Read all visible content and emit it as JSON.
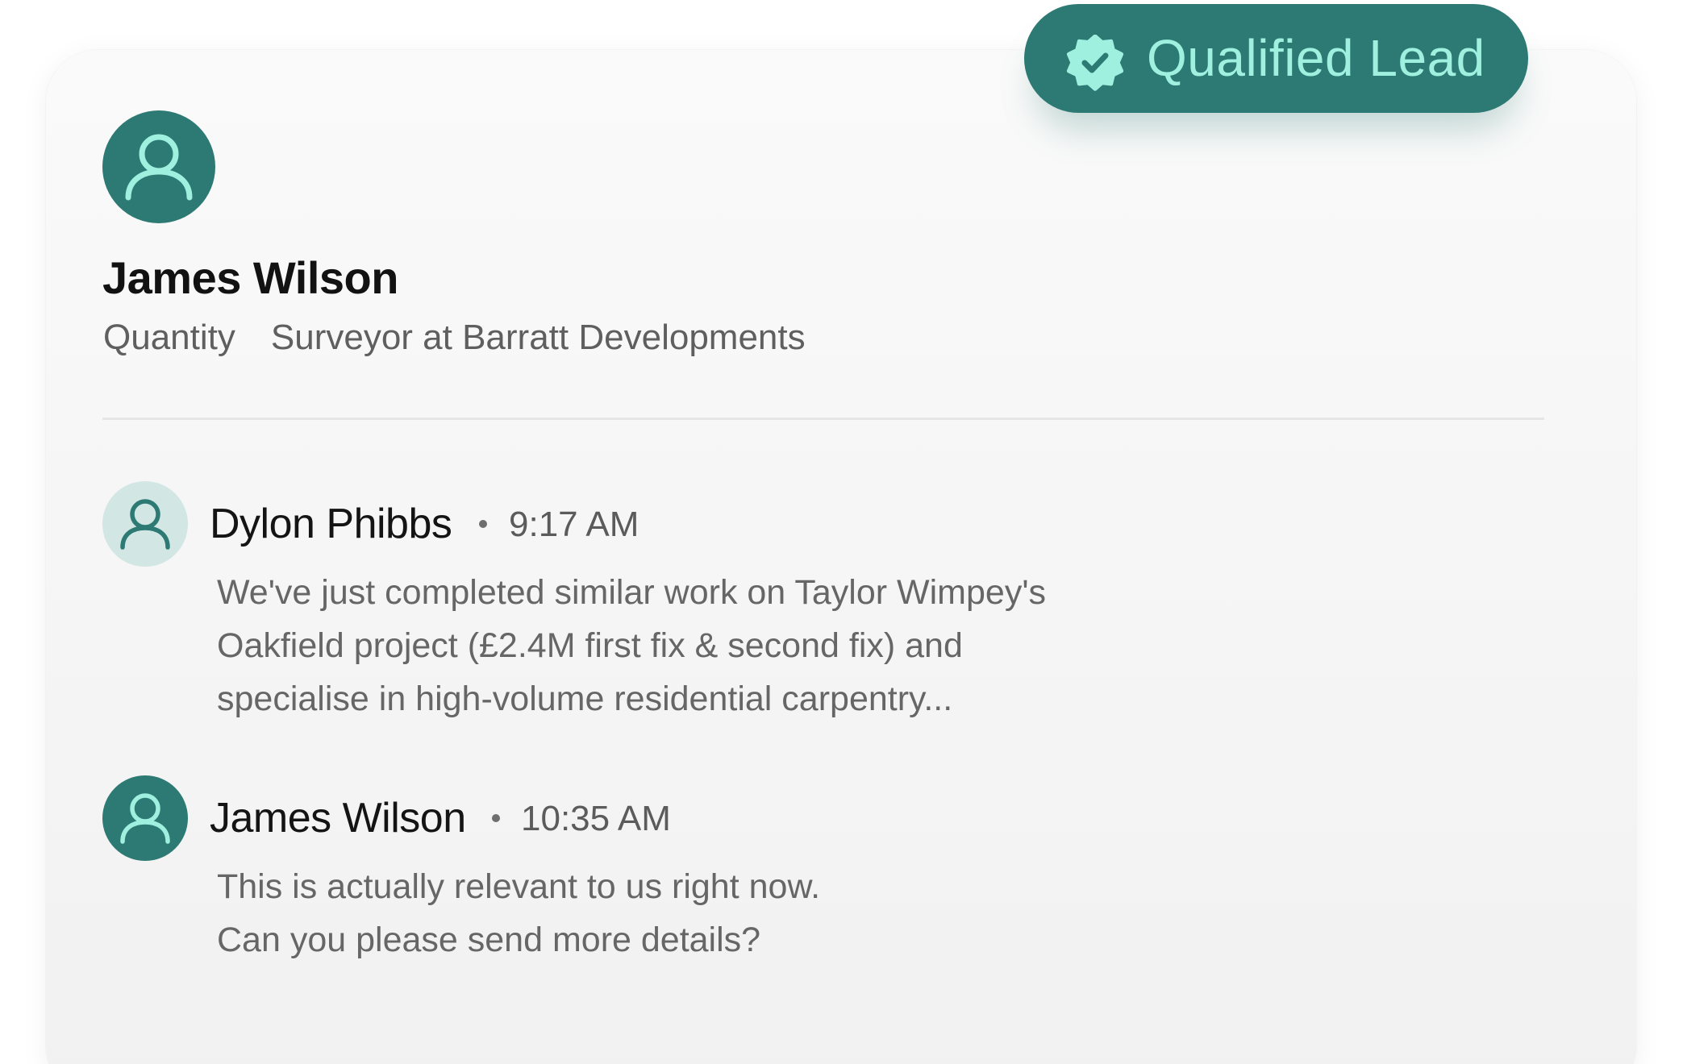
{
  "badge": {
    "label": "Qualified Lead",
    "icon": "verified-check-icon",
    "background": "#2d7a74",
    "text_color": "#9ff0df"
  },
  "profile": {
    "name": "James Wilson",
    "role_part1": "Quantity",
    "role_part2": "Surveyor at Barratt Developments",
    "avatar_icon": "user-icon"
  },
  "messages": [
    {
      "sender": "Dylon Phibbs",
      "time": "9:17 AM",
      "avatar_icon": "user-icon",
      "lines": [
        "We've just completed similar work on Taylor Wimpey's",
        "Oakfield project (£2.4M first fix & second fix) and",
        "specialise in high-volume residential carpentry..."
      ]
    },
    {
      "sender": "James Wilson",
      "time": "10:35 AM",
      "avatar_icon": "user-icon",
      "lines": [
        "This is actually relevant to us right now.",
        "Can you please send more details?"
      ]
    }
  ],
  "colors": {
    "accent": "#2d7a74",
    "accent_light": "#d2e6e3",
    "icon_light": "#9ff0df"
  }
}
